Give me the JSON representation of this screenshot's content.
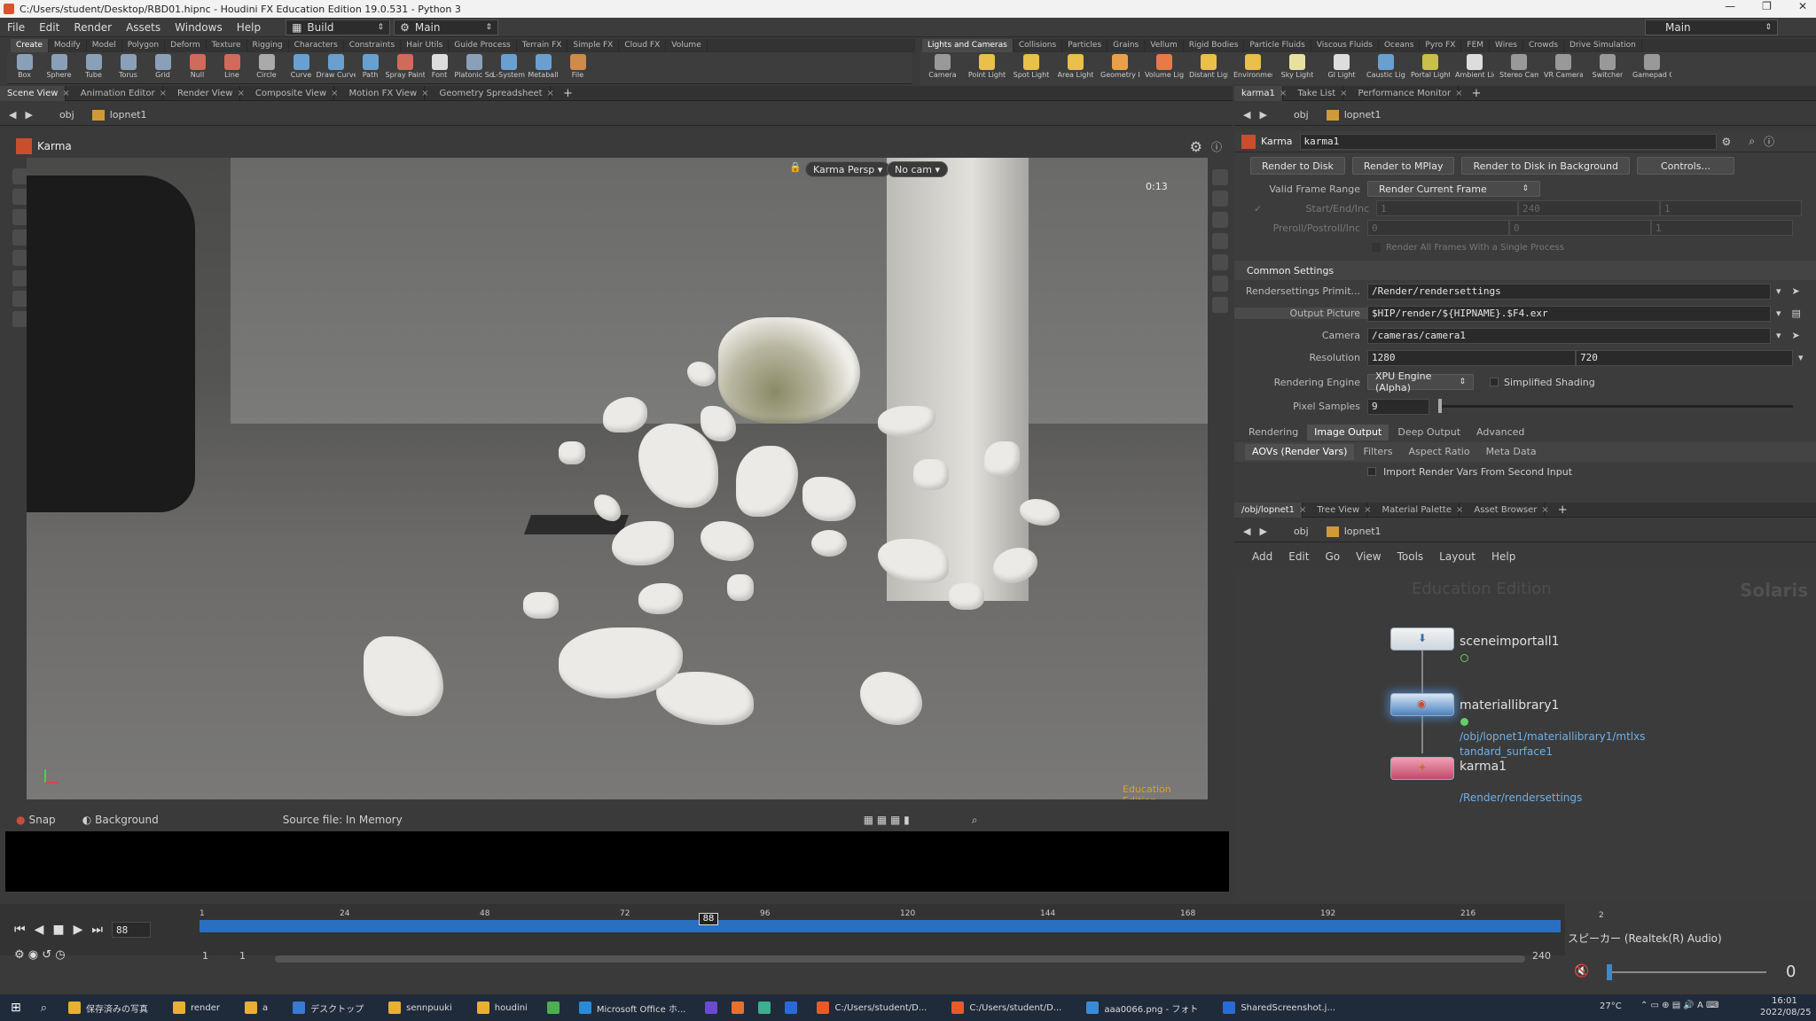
{
  "window": {
    "title": "C:/Users/student/Desktop/RBD01.hipnc - Houdini FX Education Edition 19.0.531 - Python 3",
    "controls": [
      "—",
      "❐",
      "✕"
    ]
  },
  "menubar": {
    "items": [
      "File",
      "Edit",
      "Render",
      "Assets",
      "Windows",
      "Help"
    ],
    "desktop": "Build",
    "workspace": "Main",
    "right_workspace": "Main"
  },
  "shelf_tabs_left": [
    "Create",
    "Modify",
    "Model",
    "Polygon",
    "Deform",
    "Texture",
    "Rigging",
    "Characters",
    "Constraints",
    "Hair Utils",
    "Guide Process",
    "Terrain FX",
    "Simple FX",
    "Cloud FX",
    "Volume"
  ],
  "shelf_tabs_right": [
    "Lights and Cameras",
    "Collisions",
    "Particles",
    "Grains",
    "Vellum",
    "Rigid Bodies",
    "Particle Fluids",
    "Viscous Fluids",
    "Oceans",
    "Pyro FX",
    "FEM",
    "Wires",
    "Crowds",
    "Drive Simulation"
  ],
  "shelf_tools_left": [
    {
      "label": "Box",
      "color": "#8aa0b8"
    },
    {
      "label": "Sphere",
      "color": "#8aa0b8"
    },
    {
      "label": "Tube",
      "color": "#8aa0b8"
    },
    {
      "label": "Torus",
      "color": "#8aa0b8"
    },
    {
      "label": "Grid",
      "color": "#8aa0b8"
    },
    {
      "label": "Null",
      "color": "#d06a5a"
    },
    {
      "label": "Line",
      "color": "#d06a5a"
    },
    {
      "label": "Circle",
      "color": "#aaaaaa"
    },
    {
      "label": "Curve",
      "color": "#6aa0d0"
    },
    {
      "label": "Draw Curve",
      "color": "#6aa0d0"
    },
    {
      "label": "Path",
      "color": "#6aa0d0"
    },
    {
      "label": "Spray Paint",
      "color": "#d06a5a"
    },
    {
      "label": "Font",
      "color": "#dddddd"
    },
    {
      "label": "Platonic Solids",
      "color": "#8aa0b8"
    },
    {
      "label": "L-System",
      "color": "#6aa0d0"
    },
    {
      "label": "Metaball",
      "color": "#6aa0d0"
    },
    {
      "label": "File",
      "color": "#d08a4a"
    }
  ],
  "shelf_tools_right": [
    {
      "label": "Camera",
      "color": "#999999"
    },
    {
      "label": "Point Light",
      "color": "#e8c04a"
    },
    {
      "label": "Spot Light",
      "color": "#e8c04a"
    },
    {
      "label": "Area Light",
      "color": "#e8c04a"
    },
    {
      "label": "Geometry Light",
      "color": "#e8a04a"
    },
    {
      "label": "Volume Light",
      "color": "#e87a4a"
    },
    {
      "label": "Distant Light",
      "color": "#e8c04a"
    },
    {
      "label": "Environment Light",
      "color": "#e8c04a"
    },
    {
      "label": "Sky Light",
      "color": "#e8e0a0"
    },
    {
      "label": "GI Light",
      "color": "#dddddd"
    },
    {
      "label": "Caustic Light",
      "color": "#6aa0d0"
    },
    {
      "label": "Portal Light",
      "color": "#c8c04a"
    },
    {
      "label": "Ambient Light",
      "color": "#dddddd"
    },
    {
      "label": "Stereo Camera",
      "color": "#999999"
    },
    {
      "label": "VR Camera",
      "color": "#999999"
    },
    {
      "label": "Switcher",
      "color": "#999999"
    },
    {
      "label": "Gamepad Camera",
      "color": "#999999"
    }
  ],
  "left_tabs": [
    "Scene View",
    "Animation Editor",
    "Render View",
    "Composite View",
    "Motion FX View",
    "Geometry Spreadsheet"
  ],
  "right_top_tabs": [
    "karma1",
    "Take List",
    "Performance Monitor"
  ],
  "path": {
    "root": "obj",
    "node": "lopnet1"
  },
  "viewer": {
    "renderer": "Karma",
    "camera_menu": "Karma Persp",
    "cam": "No cam",
    "time": "0:13",
    "watermark": "Education Edition"
  },
  "viewport_bottom": {
    "snap": "Snap",
    "background": "Background",
    "source": "Source file: In Memory"
  },
  "karma": {
    "type": "Karma",
    "name": "karma1",
    "buttons": [
      "Render to Disk",
      "Render to MPlay",
      "Render to Disk in Background",
      "Controls..."
    ],
    "valid_frame_range_label": "Valid Frame Range",
    "valid_frame_range": "Render Current Frame",
    "start_end_label": "Start/End/Inc",
    "start_end": [
      "1",
      "240",
      "1"
    ],
    "preroll_label": "Preroll/Postroll/Inc",
    "preroll": [
      "0",
      "0",
      "1"
    ],
    "single_process": "Render All Frames With a Single Process",
    "common_settings": "Common Settings",
    "rendersettings_label": "Rendersettings Primit...",
    "rendersettings": "/Render/rendersettings",
    "output_label": "Output Picture",
    "output": "$HIP/render/${HIPNAME}.$F4.exr",
    "camera_label": "Camera",
    "camera": "/cameras/camera1",
    "resolution_label": "Resolution",
    "res_x": "1280",
    "res_y": "720",
    "engine_label": "Rendering Engine",
    "engine": "XPU Engine (Alpha)",
    "simplified": "Simplified Shading",
    "pixel_samples_label": "Pixel Samples",
    "pixel_samples": "9",
    "tabs": [
      "Rendering",
      "Image Output",
      "Deep Output",
      "Advanced"
    ],
    "subtabs": [
      "AOVs (Render Vars)",
      "Filters",
      "Aspect Ratio",
      "Meta Data"
    ],
    "import_vars": "Import Render Vars From Second Input"
  },
  "network": {
    "tabs": [
      "/obj/lopnet1",
      "Tree View",
      "Material Palette",
      "Asset Browser"
    ],
    "menu": [
      "Add",
      "Edit",
      "Go",
      "View",
      "Tools",
      "Layout",
      "Help"
    ],
    "edition": "Education Edition",
    "context": "Solaris",
    "nodes": [
      {
        "label": "sceneimportall1",
        "path": ""
      },
      {
        "label": "materiallibrary1",
        "path": "/obj/lopnet1/materiallibrary1/mtlxs"
      },
      {
        "label": "karma1",
        "path": "/Render/rendersettings"
      }
    ],
    "node2_path2": "tandard_surface1"
  },
  "timeline": {
    "frame": "88",
    "ticks": [
      "1",
      "24",
      "48",
      "72",
      "96",
      "120",
      "144",
      "168",
      "192",
      "216"
    ],
    "marker": "88",
    "range_start": "1",
    "range_start2": "1",
    "range_end": "240",
    "end_right": "2"
  },
  "audio": {
    "device": "スピーカー (Realtek(R) Audio)",
    "volume": "0"
  },
  "taskbar": {
    "items": [
      "保存済みの写真",
      "render",
      "a",
      "デスクトップ",
      "sennpuuki",
      "houdini",
      "",
      "Microsoft Office ホ...",
      "",
      "",
      "",
      "",
      "C:/Users/student/D...",
      "C:/Users/student/D...",
      "aaa0066.png - フォト",
      "SharedScreenshot.j..."
    ],
    "temp": "27°C",
    "time": "16:01",
    "date": "2022/08/25"
  }
}
